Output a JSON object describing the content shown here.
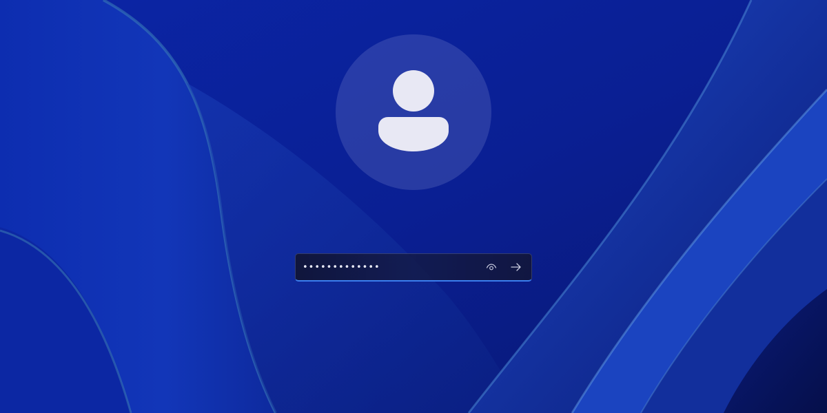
{
  "colors": {
    "background": "#0a1f95",
    "accent": "#3b7ff0",
    "avatar_glyph": "#e8e8f4"
  },
  "avatar": {
    "icon": "person-icon"
  },
  "password": {
    "value": "•••••••••••••",
    "type": "password"
  },
  "actions": {
    "reveal_icon": "eye-icon",
    "submit_icon": "arrow-right-icon"
  }
}
